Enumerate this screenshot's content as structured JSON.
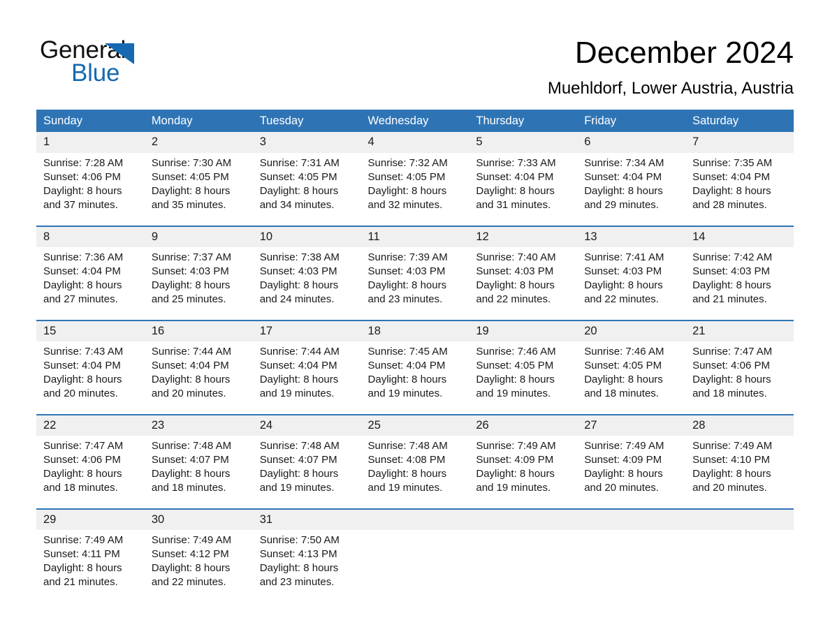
{
  "brand": {
    "name_top": "General",
    "name_bottom": "Blue",
    "triangle_color": "#1669b0",
    "text_color": "#111111"
  },
  "header": {
    "title": "December 2024",
    "subtitle": "Muehldorf, Lower Austria, Austria"
  },
  "colors": {
    "header_blue": "#2e74b5",
    "daynum_band": "#f0f0f0",
    "cell_background": "#ffffff",
    "text": "#1a1a1a",
    "header_text": "#ffffff"
  },
  "calendar": {
    "weekdays": [
      "Sunday",
      "Monday",
      "Tuesday",
      "Wednesday",
      "Thursday",
      "Friday",
      "Saturday"
    ],
    "weeks": [
      {
        "days": [
          {
            "num": "1",
            "sunrise": "Sunrise: 7:28 AM",
            "sunset": "Sunset: 4:06 PM",
            "daylight1": "Daylight: 8 hours",
            "daylight2": "and 37 minutes."
          },
          {
            "num": "2",
            "sunrise": "Sunrise: 7:30 AM",
            "sunset": "Sunset: 4:05 PM",
            "daylight1": "Daylight: 8 hours",
            "daylight2": "and 35 minutes."
          },
          {
            "num": "3",
            "sunrise": "Sunrise: 7:31 AM",
            "sunset": "Sunset: 4:05 PM",
            "daylight1": "Daylight: 8 hours",
            "daylight2": "and 34 minutes."
          },
          {
            "num": "4",
            "sunrise": "Sunrise: 7:32 AM",
            "sunset": "Sunset: 4:05 PM",
            "daylight1": "Daylight: 8 hours",
            "daylight2": "and 32 minutes."
          },
          {
            "num": "5",
            "sunrise": "Sunrise: 7:33 AM",
            "sunset": "Sunset: 4:04 PM",
            "daylight1": "Daylight: 8 hours",
            "daylight2": "and 31 minutes."
          },
          {
            "num": "6",
            "sunrise": "Sunrise: 7:34 AM",
            "sunset": "Sunset: 4:04 PM",
            "daylight1": "Daylight: 8 hours",
            "daylight2": "and 29 minutes."
          },
          {
            "num": "7",
            "sunrise": "Sunrise: 7:35 AM",
            "sunset": "Sunset: 4:04 PM",
            "daylight1": "Daylight: 8 hours",
            "daylight2": "and 28 minutes."
          }
        ]
      },
      {
        "days": [
          {
            "num": "8",
            "sunrise": "Sunrise: 7:36 AM",
            "sunset": "Sunset: 4:04 PM",
            "daylight1": "Daylight: 8 hours",
            "daylight2": "and 27 minutes."
          },
          {
            "num": "9",
            "sunrise": "Sunrise: 7:37 AM",
            "sunset": "Sunset: 4:03 PM",
            "daylight1": "Daylight: 8 hours",
            "daylight2": "and 25 minutes."
          },
          {
            "num": "10",
            "sunrise": "Sunrise: 7:38 AM",
            "sunset": "Sunset: 4:03 PM",
            "daylight1": "Daylight: 8 hours",
            "daylight2": "and 24 minutes."
          },
          {
            "num": "11",
            "sunrise": "Sunrise: 7:39 AM",
            "sunset": "Sunset: 4:03 PM",
            "daylight1": "Daylight: 8 hours",
            "daylight2": "and 23 minutes."
          },
          {
            "num": "12",
            "sunrise": "Sunrise: 7:40 AM",
            "sunset": "Sunset: 4:03 PM",
            "daylight1": "Daylight: 8 hours",
            "daylight2": "and 22 minutes."
          },
          {
            "num": "13",
            "sunrise": "Sunrise: 7:41 AM",
            "sunset": "Sunset: 4:03 PM",
            "daylight1": "Daylight: 8 hours",
            "daylight2": "and 22 minutes."
          },
          {
            "num": "14",
            "sunrise": "Sunrise: 7:42 AM",
            "sunset": "Sunset: 4:03 PM",
            "daylight1": "Daylight: 8 hours",
            "daylight2": "and 21 minutes."
          }
        ]
      },
      {
        "days": [
          {
            "num": "15",
            "sunrise": "Sunrise: 7:43 AM",
            "sunset": "Sunset: 4:04 PM",
            "daylight1": "Daylight: 8 hours",
            "daylight2": "and 20 minutes."
          },
          {
            "num": "16",
            "sunrise": "Sunrise: 7:44 AM",
            "sunset": "Sunset: 4:04 PM",
            "daylight1": "Daylight: 8 hours",
            "daylight2": "and 20 minutes."
          },
          {
            "num": "17",
            "sunrise": "Sunrise: 7:44 AM",
            "sunset": "Sunset: 4:04 PM",
            "daylight1": "Daylight: 8 hours",
            "daylight2": "and 19 minutes."
          },
          {
            "num": "18",
            "sunrise": "Sunrise: 7:45 AM",
            "sunset": "Sunset: 4:04 PM",
            "daylight1": "Daylight: 8 hours",
            "daylight2": "and 19 minutes."
          },
          {
            "num": "19",
            "sunrise": "Sunrise: 7:46 AM",
            "sunset": "Sunset: 4:05 PM",
            "daylight1": "Daylight: 8 hours",
            "daylight2": "and 19 minutes."
          },
          {
            "num": "20",
            "sunrise": "Sunrise: 7:46 AM",
            "sunset": "Sunset: 4:05 PM",
            "daylight1": "Daylight: 8 hours",
            "daylight2": "and 18 minutes."
          },
          {
            "num": "21",
            "sunrise": "Sunrise: 7:47 AM",
            "sunset": "Sunset: 4:06 PM",
            "daylight1": "Daylight: 8 hours",
            "daylight2": "and 18 minutes."
          }
        ]
      },
      {
        "days": [
          {
            "num": "22",
            "sunrise": "Sunrise: 7:47 AM",
            "sunset": "Sunset: 4:06 PM",
            "daylight1": "Daylight: 8 hours",
            "daylight2": "and 18 minutes."
          },
          {
            "num": "23",
            "sunrise": "Sunrise: 7:48 AM",
            "sunset": "Sunset: 4:07 PM",
            "daylight1": "Daylight: 8 hours",
            "daylight2": "and 18 minutes."
          },
          {
            "num": "24",
            "sunrise": "Sunrise: 7:48 AM",
            "sunset": "Sunset: 4:07 PM",
            "daylight1": "Daylight: 8 hours",
            "daylight2": "and 19 minutes."
          },
          {
            "num": "25",
            "sunrise": "Sunrise: 7:48 AM",
            "sunset": "Sunset: 4:08 PM",
            "daylight1": "Daylight: 8 hours",
            "daylight2": "and 19 minutes."
          },
          {
            "num": "26",
            "sunrise": "Sunrise: 7:49 AM",
            "sunset": "Sunset: 4:09 PM",
            "daylight1": "Daylight: 8 hours",
            "daylight2": "and 19 minutes."
          },
          {
            "num": "27",
            "sunrise": "Sunrise: 7:49 AM",
            "sunset": "Sunset: 4:09 PM",
            "daylight1": "Daylight: 8 hours",
            "daylight2": "and 20 minutes."
          },
          {
            "num": "28",
            "sunrise": "Sunrise: 7:49 AM",
            "sunset": "Sunset: 4:10 PM",
            "daylight1": "Daylight: 8 hours",
            "daylight2": "and 20 minutes."
          }
        ]
      },
      {
        "days": [
          {
            "num": "29",
            "sunrise": "Sunrise: 7:49 AM",
            "sunset": "Sunset: 4:11 PM",
            "daylight1": "Daylight: 8 hours",
            "daylight2": "and 21 minutes."
          },
          {
            "num": "30",
            "sunrise": "Sunrise: 7:49 AM",
            "sunset": "Sunset: 4:12 PM",
            "daylight1": "Daylight: 8 hours",
            "daylight2": "and 22 minutes."
          },
          {
            "num": "31",
            "sunrise": "Sunrise: 7:50 AM",
            "sunset": "Sunset: 4:13 PM",
            "daylight1": "Daylight: 8 hours",
            "daylight2": "and 23 minutes."
          },
          {
            "num": "",
            "sunrise": "",
            "sunset": "",
            "daylight1": "",
            "daylight2": ""
          },
          {
            "num": "",
            "sunrise": "",
            "sunset": "",
            "daylight1": "",
            "daylight2": ""
          },
          {
            "num": "",
            "sunrise": "",
            "sunset": "",
            "daylight1": "",
            "daylight2": ""
          },
          {
            "num": "",
            "sunrise": "",
            "sunset": "",
            "daylight1": "",
            "daylight2": ""
          }
        ]
      }
    ]
  }
}
